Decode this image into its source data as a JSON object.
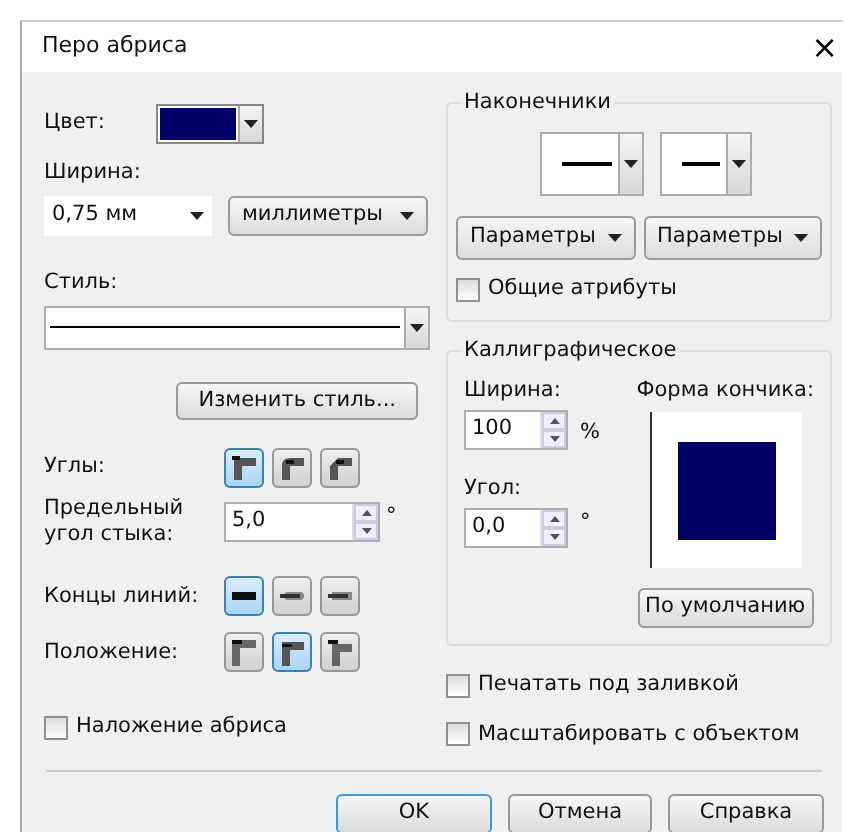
{
  "window": {
    "title": "Перо абриса",
    "close": "×"
  },
  "color": {
    "label": "Цвет:",
    "color": "#000066"
  },
  "width": {
    "label": "Ширина:",
    "value": "0,75 мм",
    "units": "миллиметры"
  },
  "style": {
    "label": "Стиль:"
  },
  "edit_style_button": "Изменить стиль...",
  "corners": {
    "label": "Углы:",
    "options": [
      {
        "kind": "miter",
        "selected": true
      },
      {
        "kind": "round",
        "selected": false
      },
      {
        "kind": "bevel",
        "selected": false
      }
    ]
  },
  "miter_limit": {
    "label": "Предельный угол стыка:",
    "value": "5,0",
    "unit": "°"
  },
  "line_caps": {
    "label": "Концы линий:",
    "options": [
      {
        "kind": "butt",
        "selected": true
      },
      {
        "kind": "round",
        "selected": false
      },
      {
        "kind": "square",
        "selected": false
      }
    ]
  },
  "position": {
    "label": "Положение:",
    "options": [
      {
        "kind": "outside",
        "selected": false
      },
      {
        "kind": "center",
        "selected": true
      },
      {
        "kind": "inside",
        "selected": false
      }
    ]
  },
  "overprint": {
    "label": "Наложение абриса",
    "checked": false
  },
  "arrows": {
    "title": "Наконечники",
    "buttons": [
      "Параметры",
      "Параметры"
    ],
    "share": {
      "label": "Общие атрибуты",
      "checked": false
    }
  },
  "calligraphic": {
    "title": "Каллиграфическое",
    "width_label": "Ширина:",
    "width_value": "100",
    "width_unit": "%",
    "angle_label": "Угол:",
    "angle_value": "0,0",
    "angle_unit": "°",
    "nib_label": "Форма кончика:",
    "nib": {
      "color": "#000066"
    },
    "default_button": "По умолчанию"
  },
  "checks": [
    {
      "label": "Печатать под заливкой",
      "checked": false
    },
    {
      "label": "Масштабировать с объектом",
      "checked": false
    }
  ],
  "buttons": [
    {
      "label": "OK",
      "default": true
    },
    {
      "label": "Отмена",
      "default": false
    },
    {
      "label": "Справка",
      "default": false
    }
  ]
}
